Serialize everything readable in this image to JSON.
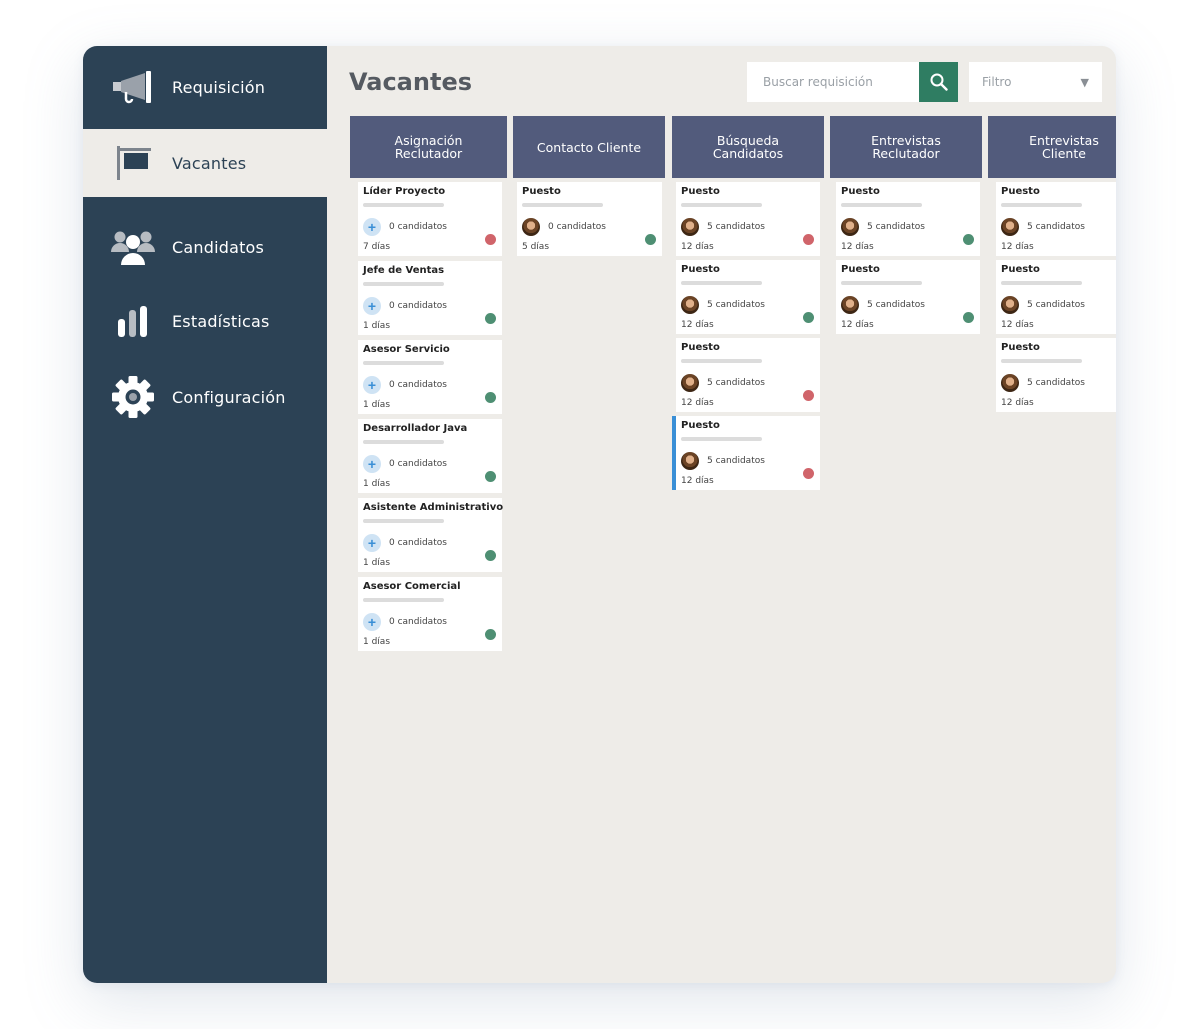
{
  "sidebar": {
    "items": [
      {
        "label": "Requisición",
        "icon": "megaphone-icon",
        "active": false
      },
      {
        "label": "Vacantes",
        "icon": "flag-sign-icon",
        "active": true
      },
      {
        "label": "Candidatos",
        "icon": "users-icon",
        "active": false
      },
      {
        "label": "Estadísticas",
        "icon": "bar-chart-icon",
        "active": false
      },
      {
        "label": "Configuración",
        "icon": "gear-icon",
        "active": false
      }
    ]
  },
  "header": {
    "title": "Vacantes",
    "search_placeholder": "Buscar requisición",
    "search_icon": "search-icon",
    "filter_label": "Filtro",
    "filter_caret": "▼"
  },
  "colors": {
    "sidebar": "#2c4255",
    "column_header": "#525b7c",
    "search_button": "#2f7d62",
    "status_ok": "#4e8f73",
    "status_alert": "#d0646a",
    "selected_accent": "#3a8fd6"
  },
  "columns": [
    {
      "title": "Asignación Reclutador",
      "cards": [
        {
          "title": "Líder Proyecto",
          "count": "0 candidatos",
          "days": "7 días",
          "status": "red",
          "avatar": "add"
        },
        {
          "title": "Jefe de Ventas",
          "count": "0 candidatos",
          "days": "1 días",
          "status": "green",
          "avatar": "add"
        },
        {
          "title": "Asesor Servicio",
          "count": "0 candidatos",
          "days": "1 días",
          "status": "green",
          "avatar": "add"
        },
        {
          "title": "Desarrollador Java",
          "count": "0 candidatos",
          "days": "1 días",
          "status": "green",
          "avatar": "add"
        },
        {
          "title": "Asistente Administrativo",
          "count": "0 candidatos",
          "days": "1 días",
          "status": "green",
          "avatar": "add"
        },
        {
          "title": "Asesor Comercial",
          "count": "0 candidatos",
          "days": "1 días",
          "status": "green",
          "avatar": "add"
        }
      ]
    },
    {
      "title": "Contacto Cliente",
      "cards": [
        {
          "title": "Puesto",
          "count": "0 candidatos",
          "days": "5 días",
          "status": "green",
          "avatar": "photo"
        }
      ]
    },
    {
      "title": "Búsqueda Candidatos",
      "cards": [
        {
          "title": "Puesto",
          "count": "5 candidatos",
          "days": "12 días",
          "status": "red",
          "avatar": "photo"
        },
        {
          "title": "Puesto",
          "count": "5 candidatos",
          "days": "12 días",
          "status": "green",
          "avatar": "photo"
        },
        {
          "title": "Puesto",
          "count": "5 candidatos",
          "days": "12 días",
          "status": "red",
          "avatar": "photo"
        },
        {
          "title": "Puesto",
          "count": "5 candidatos",
          "days": "12 días",
          "status": "red",
          "avatar": "photo",
          "selected": true
        }
      ]
    },
    {
      "title": "Entrevistas Reclutador",
      "cards": [
        {
          "title": "Puesto",
          "count": "5 candidatos",
          "days": "12 días",
          "status": "green",
          "avatar": "photo"
        },
        {
          "title": "Puesto",
          "count": "5 candidatos",
          "days": "12 días",
          "status": "green",
          "avatar": "photo"
        }
      ]
    },
    {
      "title": "Entrevistas Cliente",
      "cards": [
        {
          "title": "Puesto",
          "count": "5 candidatos",
          "days": "12 días",
          "status": "none",
          "avatar": "photo"
        },
        {
          "title": "Puesto",
          "count": "5 candidatos",
          "days": "12 días",
          "status": "none",
          "avatar": "photo"
        },
        {
          "title": "Puesto",
          "count": "5 candidatos",
          "days": "12 días",
          "status": "none",
          "avatar": "photo"
        }
      ]
    }
  ]
}
